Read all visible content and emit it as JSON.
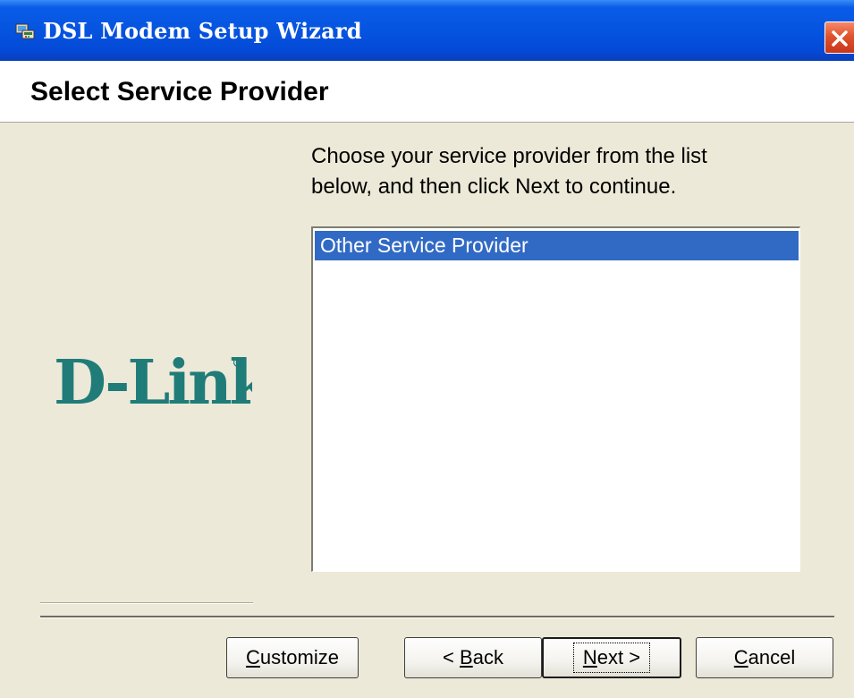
{
  "window": {
    "title": "DSL Modem Setup Wizard",
    "icon": "modem-wizard-icon",
    "close_icon": "close-icon"
  },
  "header": {
    "title": "Select Service Provider"
  },
  "logo": {
    "text": "D-Link",
    "color": "#1f7c78"
  },
  "instructions": {
    "line1": "Choose your service provider from the list",
    "line2": "below, and then click Next to continue."
  },
  "provider_list": {
    "items": [
      {
        "label": "Other Service Provider",
        "selected": true
      }
    ],
    "selection_color": "#316ac5"
  },
  "buttons": {
    "customize": {
      "pre": "",
      "accel": "C",
      "post": "ustomize"
    },
    "back": {
      "pre": "< ",
      "accel": "B",
      "post": "ack"
    },
    "next": {
      "pre": "",
      "accel": "N",
      "post": "ext >"
    },
    "cancel": {
      "pre": "",
      "accel": "C",
      "post": "ancel"
    }
  }
}
